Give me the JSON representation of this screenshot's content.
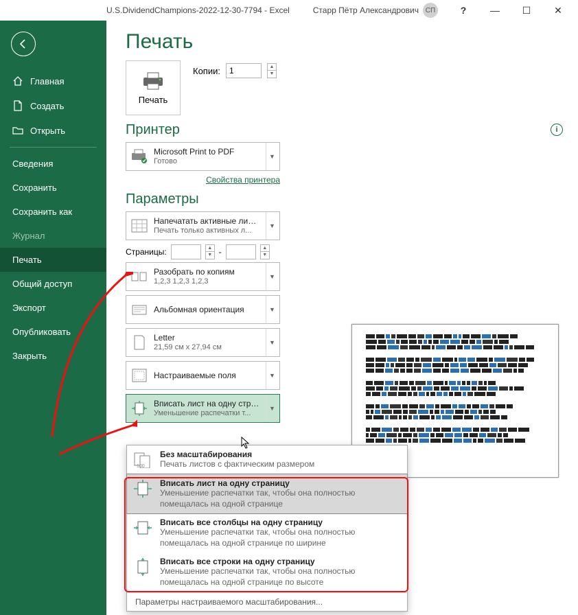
{
  "titlebar": {
    "doc": "U.S.DividendChampions-2022-12-30-7794  -  Excel",
    "user": "Старр Пётр Александрович",
    "initials": "СП"
  },
  "sidebar": {
    "home": "Главная",
    "new": "Создать",
    "open": "Открыть",
    "info": "Сведения",
    "save": "Сохранить",
    "saveas": "Сохранить как",
    "history": "Журнал",
    "print": "Печать",
    "share": "Общий доступ",
    "export": "Экспорт",
    "publish": "Опубликовать",
    "close": "Закрыть"
  },
  "print": {
    "title": "Печать",
    "button": "Печать",
    "copies_label": "Копии:",
    "copies_value": "1",
    "printer_heading": "Принтер",
    "printer_name": "Microsoft Print to PDF",
    "printer_status": "Готово",
    "printer_props": "Свойства принтера",
    "params_heading": "Параметры",
    "what_line1": "Напечатать активные листы",
    "what_line2": "Печать только активных л...",
    "pages_label": "Страницы:",
    "collate_line1": "Разобрать по копиям",
    "collate_line2": "1,2,3    1,2,3    1,2,3",
    "orientation": "Альбомная ориентация",
    "paper_line1": "Letter",
    "paper_line2": "21,59 см x 27,94 см",
    "margins": "Настраиваемые поля",
    "scale_line1": "Вписать лист на одну стра...",
    "scale_line2": "Уменьшение распечатки т..."
  },
  "popup": {
    "none_t": "Без масштабирования",
    "none_d": "Печать листов с фактическим размером",
    "fit_t": "Вписать лист на одну страницу",
    "fit_d": "Уменьшение распечатки так, чтобы она полностью помещалась на одной странице",
    "cols_t": "Вписать все столбцы на одну страницу",
    "cols_d": "Уменьшение распечатки так, чтобы она полностью помещалась на одной странице по ширине",
    "rows_t": "Вписать все строки на одну страницу",
    "rows_d": "Уменьшение распечатки так, чтобы она полностью помещалась на одной странице по высоте",
    "footer": "Параметры настраиваемого масштабирования..."
  }
}
